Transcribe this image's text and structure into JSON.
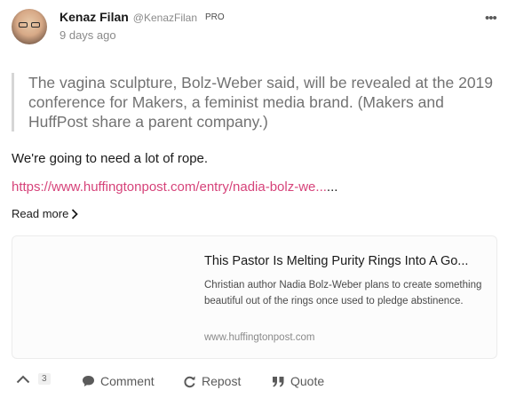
{
  "post": {
    "author_name": "Kenaz Filan",
    "author_handle": "@KenazFilan",
    "badge": "PRO",
    "timestamp": "9 days ago",
    "quote_text": "The vagina sculpture, Bolz-Weber said, will be revealed at the 2019 conference for Makers, a feminist media brand. (Makers and HuffPost share a parent company.)",
    "body_text": "We're going to need a lot of rope.",
    "link_text": "https://www.huffingtonpost.com/entry/nadia-bolz-we...",
    "link_suffix": "...",
    "read_more": "Read more"
  },
  "link_preview": {
    "title": "This Pastor Is Melting Purity Rings Into A Go...",
    "description": "Christian author Nadia Bolz-Weber plans to create something beautiful out of the rings once used to pledge abstinence.",
    "domain": "www.huffingtonpost.com"
  },
  "actions": {
    "upvote_count": "3",
    "comment_label": "Comment",
    "repost_label": "Repost",
    "quote_label": "Quote"
  },
  "icons": [
    "more-icon",
    "chevron-right-icon",
    "upvote-icon",
    "comment-icon",
    "repost-icon",
    "quote-icon"
  ],
  "colors": {
    "link": "#d6437a",
    "muted": "#8a8a8a",
    "quote_border": "#d6d6d6"
  }
}
